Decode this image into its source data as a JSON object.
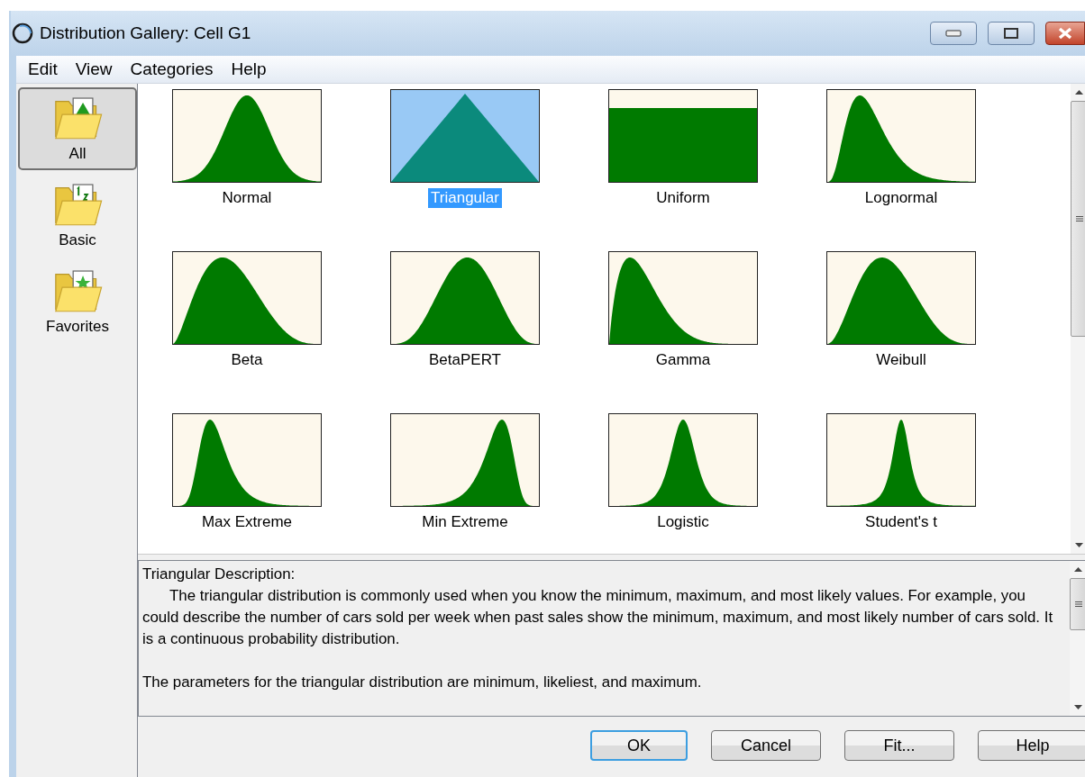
{
  "window": {
    "title": "Distribution Gallery: Cell G1"
  },
  "menu": [
    "Edit",
    "View",
    "Categories",
    "Help"
  ],
  "categories": [
    {
      "label": "All",
      "kind": "chart",
      "selected": true
    },
    {
      "label": "Basic",
      "kind": "numbers",
      "selected": false
    },
    {
      "label": "Favorites",
      "kind": "star",
      "selected": false
    }
  ],
  "distributions": [
    {
      "name": "Normal",
      "kind": "normal",
      "selected": false
    },
    {
      "name": "Triangular",
      "kind": "triangular",
      "selected": true
    },
    {
      "name": "Uniform",
      "kind": "uniform",
      "selected": false
    },
    {
      "name": "Lognormal",
      "kind": "lognormal",
      "selected": false
    },
    {
      "name": "Beta",
      "kind": "beta",
      "selected": false
    },
    {
      "name": "BetaPERT",
      "kind": "betapert",
      "selected": false
    },
    {
      "name": "Gamma",
      "kind": "gamma",
      "selected": false
    },
    {
      "name": "Weibull",
      "kind": "weibull",
      "selected": false
    },
    {
      "name": "Max Extreme",
      "kind": "maxextreme",
      "selected": false
    },
    {
      "name": "Min Extreme",
      "kind": "minextreme",
      "selected": false
    },
    {
      "name": "Logistic",
      "kind": "logistic",
      "selected": false
    },
    {
      "name": "Student's t",
      "kind": "studentt",
      "selected": false
    }
  ],
  "description": {
    "title": "Triangular Description:",
    "paragraphs": [
      "The triangular distribution is commonly used when you know the minimum, maximum, and most likely values. For example, you could describe the number of cars sold per week when past sales show the minimum, maximum, and most likely number of cars sold. It is a continuous probability distribution.",
      "The parameters for the triangular distribution are minimum, likeliest, and maximum."
    ]
  },
  "buttons": [
    {
      "label": "OK",
      "default": true
    },
    {
      "label": "Cancel",
      "default": false
    },
    {
      "label": "Fit...",
      "default": false
    },
    {
      "label": "Help",
      "default": false
    }
  ]
}
